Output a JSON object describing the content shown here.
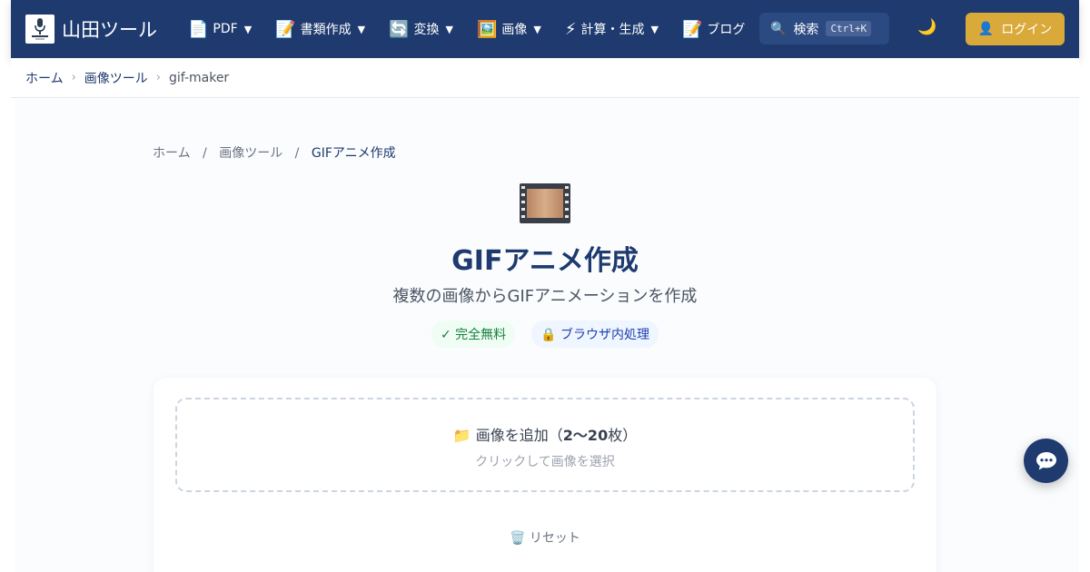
{
  "header": {
    "site_name": "山田ツール",
    "nav": [
      {
        "icon": "📄",
        "label": "PDF",
        "caret": "▼"
      },
      {
        "icon": "📝",
        "label": "書類作成",
        "caret": "▼"
      },
      {
        "icon": "🔄",
        "label": "変換",
        "caret": "▼"
      },
      {
        "icon": "🖼️",
        "label": "画像",
        "caret": "▼"
      },
      {
        "icon": "⚡",
        "label": "計算・生成",
        "caret": "▼"
      },
      {
        "icon": "📝",
        "label": "ブログ",
        "caret": ""
      }
    ],
    "search": {
      "icon": "🔍",
      "label": "検索",
      "shortcut": "Ctrl+K"
    },
    "theme_icon": "🌙",
    "login": {
      "icon": "👤",
      "label": "ログイン"
    }
  },
  "breadcrumb": {
    "home": "ホーム",
    "category": "画像ツール",
    "current": "gif-maker",
    "sep": "›"
  },
  "page": {
    "crumb": {
      "home": "ホーム",
      "category": "画像ツール",
      "current": "GIFアニメ作成",
      "sep": "/"
    },
    "title_bold": "GIF",
    "title_rest": "アニメ作成",
    "subtitle": "複数の画像からGIFアニメーションを作成",
    "badges": {
      "free": "✓ 完全無料",
      "local": "🔒 ブラウザ内処理"
    },
    "dropzone": {
      "icon": "📁",
      "title_pre": "画像を追加（",
      "title_bold": "2〜20",
      "title_post": "枚）",
      "hint": "クリックして画像を選択"
    },
    "reset": "🗑️ リセット"
  },
  "colors": {
    "header_bg": "#1e3a6e",
    "login_bg": "#d9a93a",
    "free_badge": "#15803d",
    "local_badge": "#1e40af"
  }
}
